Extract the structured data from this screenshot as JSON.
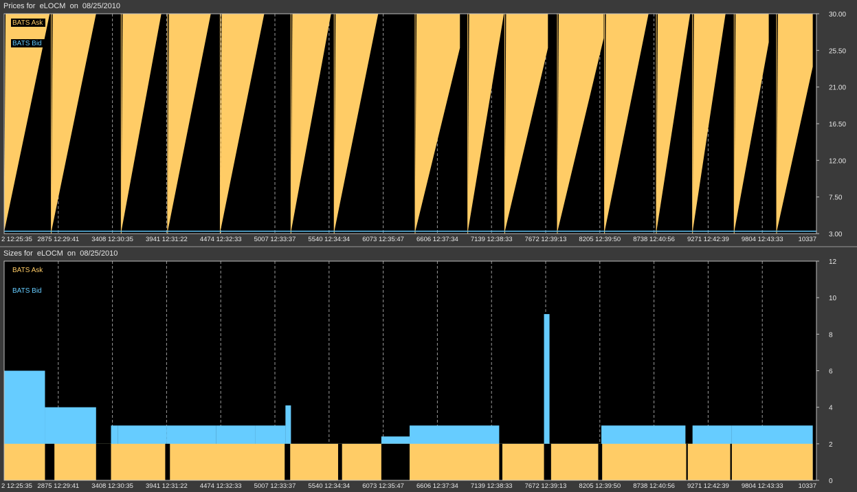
{
  "charts": {
    "prices": {
      "title": "Prices for  eLOCM  on  08/25/2010",
      "legend": [
        {
          "name": "BATS Ask",
          "color": "#ffcc66"
        },
        {
          "name": "BATS Bid",
          "color": "#66ccff"
        }
      ]
    },
    "sizes": {
      "title": "Sizes for  eLOCM  on  08/25/2010",
      "legend": [
        {
          "name": "BATS Ask",
          "color": "#ffcc66"
        },
        {
          "name": "BATS Bid",
          "color": "#66ccff"
        }
      ]
    }
  },
  "chart_data": [
    {
      "type": "area",
      "title": "Prices for  eLOCM  on  08/25/2010",
      "x_tick_labels": [
        "2 12:25:35",
        "2875 12:29:41",
        "3408 12:30:35",
        "3941 12:31:22",
        "4474 12:32:33",
        "5007 12:33:37",
        "5540 12:34:34",
        "6073 12:35:47",
        "6606 12:37:34",
        "7139 12:38:33",
        "7672 12:39:13",
        "8205 12:39:50",
        "8738 12:40:56",
        "9271 12:42:39",
        "9804 12:43:33",
        "10337"
      ],
      "y_tick_labels": [
        "30.00",
        "25.50",
        "21.00",
        "16.50",
        "12.00",
        "7.50",
        "3.00"
      ],
      "ylim": [
        3.0,
        30.0
      ],
      "xlim": [
        0,
        10337
      ],
      "grid": true,
      "legend_position": "top-left",
      "series": [
        {
          "name": "BATS Ask",
          "color": "#ffcc66",
          "sawtooth_segments": [
            [
              0,
              580,
              3.2,
              30.0
            ],
            [
              600,
              1170,
              3.2,
              30.0
            ],
            [
              1490,
              2000,
              3.2,
              30.0
            ],
            [
              2080,
              2630,
              3.2,
              30.0
            ],
            [
              2750,
              3310,
              3.2,
              30.0
            ],
            [
              3650,
              4160,
              3.2,
              30.0
            ],
            [
              4200,
              4760,
              3.2,
              30.0
            ],
            [
              5230,
              5800,
              3.2,
              25.8
            ],
            [
              5900,
              6360,
              3.2,
              30.0
            ],
            [
              6370,
              6920,
              3.2,
              25.8
            ],
            [
              7040,
              7630,
              3.2,
              27.0
            ],
            [
              7640,
              8200,
              3.2,
              30.0
            ],
            [
              8300,
              8730,
              3.2,
              30.0
            ],
            [
              8760,
              9180,
              3.2,
              30.0
            ],
            [
              9290,
              9730,
              3.2,
              26.5
            ],
            [
              9830,
              10290,
              3.2,
              23.5
            ]
          ]
        },
        {
          "name": "BATS Bid",
          "color": "#66ccff",
          "approx_level": 3.3
        }
      ]
    },
    {
      "type": "area",
      "title": "Sizes for  eLOCM  on  08/25/2010",
      "x_tick_labels": [
        "2 12:25:35",
        "2875 12:29:41",
        "3408 12:30:35",
        "3941 12:31:22",
        "4474 12:32:33",
        "5007 12:33:37",
        "5540 12:34:34",
        "6073 12:35:47",
        "6606 12:37:34",
        "7139 12:38:33",
        "7672 12:39:13",
        "8205 12:39:50",
        "8738 12:40:56",
        "9271 12:42:39",
        "9804 12:43:33",
        "10337"
      ],
      "y_tick_labels": [
        "12",
        "10",
        "8",
        "6",
        "4",
        "2",
        "0"
      ],
      "ylim": [
        0,
        12
      ],
      "xlim": [
        0,
        10337
      ],
      "grid": true,
      "legend_position": "top-left",
      "series": [
        {
          "name": "BATS Bid",
          "color": "#66ccff",
          "steps": [
            [
              0,
              520,
              6
            ],
            [
              520,
              1170,
              4
            ],
            [
              1170,
              1360,
              2
            ],
            [
              1360,
              1450,
              3
            ],
            [
              1450,
              2070,
              3
            ],
            [
              2070,
              2700,
              3
            ],
            [
              2700,
              3200,
              3
            ],
            [
              3200,
              3580,
              3
            ],
            [
              3580,
              3650,
              4.1
            ],
            [
              3650,
              4300,
              2
            ],
            [
              4300,
              4800,
              2
            ],
            [
              4800,
              5160,
              2.4
            ],
            [
              5160,
              6300,
              3
            ],
            [
              6300,
              6870,
              2
            ],
            [
              6870,
              6940,
              9.1
            ],
            [
              6940,
              7600,
              2
            ],
            [
              7600,
              8670,
              3
            ],
            [
              8670,
              8760,
              2
            ],
            [
              8760,
              9260,
              3
            ],
            [
              9260,
              10290,
              3
            ]
          ]
        },
        {
          "name": "BATS Ask",
          "color": "#ffcc66",
          "steps": [
            [
              0,
              10290,
              2
            ]
          ],
          "gaps": [
            [
              520,
              640
            ],
            [
              1170,
              1360
            ],
            [
              2050,
              2110
            ],
            [
              3570,
              3640
            ],
            [
              4250,
              4300
            ],
            [
              4800,
              5160
            ],
            [
              6300,
              6340
            ],
            [
              6870,
              6960
            ],
            [
              7560,
              7610
            ],
            [
              8680,
              8700
            ],
            [
              9240,
              9260
            ]
          ]
        }
      ]
    }
  ]
}
